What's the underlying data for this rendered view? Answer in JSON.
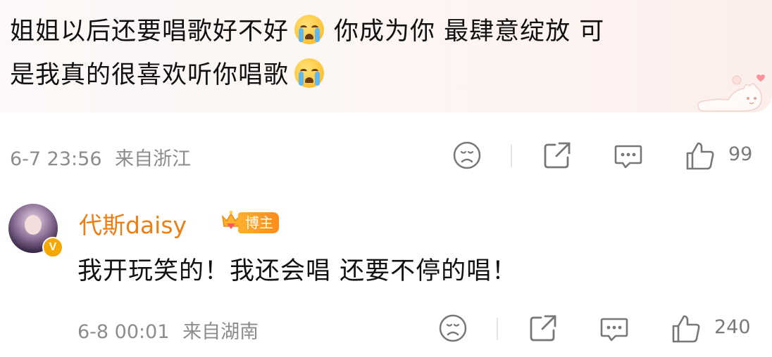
{
  "comment": {
    "text_part1": "姐姐以后还要唱歌好不好",
    "text_part2": "你成为你 最肆意绽放 可",
    "text_part3": "是我真的很喜欢听你唱歌",
    "emoji_name": "crying-emoji",
    "timestamp": "6-7 23:56",
    "location": "来自浙江",
    "likes": "99"
  },
  "reply": {
    "username": "代斯daisy",
    "role_badge": "博主",
    "verified_badge": "V",
    "text": "我开玩笑的！我还会唱 还要不停的唱！",
    "timestamp": "6-8 00:01",
    "location": "来自湖南",
    "likes": "240"
  },
  "icons": {
    "dislike": "frown-face-icon",
    "share": "share-icon",
    "comment": "comment-bubble-icon",
    "like": "thumbs-up-icon"
  },
  "colors": {
    "username": "#ee7d12",
    "meta": "#8c8c8c",
    "badge": "#ff9a22"
  }
}
